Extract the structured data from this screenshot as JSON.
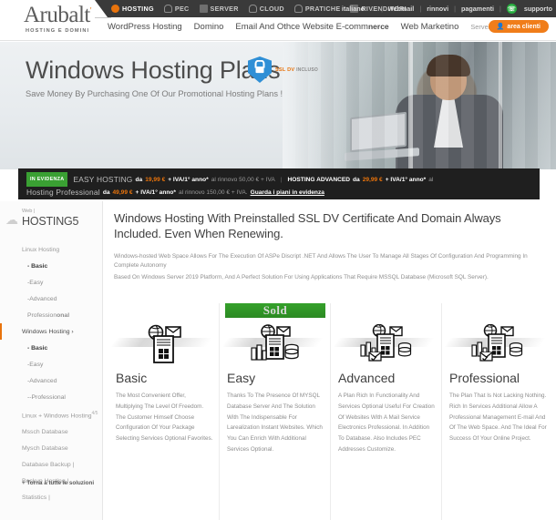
{
  "topbar": {
    "items": [
      {
        "label": "HOSTING",
        "icon": "globe-icon",
        "active": true
      },
      {
        "label": "PEC",
        "icon": "pin-icon",
        "active": false
      },
      {
        "label": "SERVER",
        "icon": "server-icon",
        "active": false
      },
      {
        "label": "CLOUD",
        "icon": "cloud-icon",
        "active": false
      },
      {
        "label": "PRATICHE",
        "icon": "check-circle-icon",
        "active": false
      },
      {
        "label": "RIVENDITORI",
        "icon": "list-icon",
        "active": false
      }
    ],
    "right": {
      "language": "italiano",
      "webmail": "webmail",
      "rinnovi": "rinnovi",
      "pagamenti": "pagamenti",
      "supporto": "supporto",
      "separator": "|"
    }
  },
  "header": {
    "logo": "Arubalt",
    "logo_tm": "'",
    "logo_sub": "HOSTING E DOMINI",
    "nav": [
      {
        "label": "WordPress Hosting",
        "style": "normal"
      },
      {
        "label": "Domino",
        "style": "normal"
      },
      {
        "label": "Email And Othce Website E-comm",
        "style": "normal"
      },
      {
        "label": "nerce",
        "style": "bold"
      },
      {
        "label": "Web Marketino",
        "style": "normal"
      },
      {
        "label": "Server And Cloud |",
        "style": "faint"
      }
    ],
    "area_clienti": "area clienti",
    "area_clienti_icon": "user-icon"
  },
  "hero": {
    "title": "Windows Hosting Plans",
    "subtitle": "Save Money By Purchasing One Of Our Promotional Hosting Plans !",
    "ssl_badge": {
      "text": "SSL DV",
      "suffix": "INCLUSO",
      "icon": "shield-lock-icon"
    }
  },
  "promo": {
    "tag": "IN EVIDENZA",
    "line1": {
      "name": "EASY HOSTING",
      "da": "da",
      "price": "19,99 €",
      "vat": "+ IVA/1° anno*",
      "renewal": "al rinnovo 50,00 € + IVA",
      "separator": "|",
      "name2": "HOSTING ADVANCED",
      "da2": "da",
      "price2": "29,99 €",
      "vat2": "+ IVA/1° anno*",
      "renewal2": "al"
    },
    "line2": {
      "name": "Hosting Professional",
      "da": "da",
      "price": "49,99 €",
      "vat": "+ IVA/1° anno*",
      "renewal": "al rinnovo 150,00 € + IVA.",
      "link": "Guarda i piani in evidenza"
    }
  },
  "sidebar": {
    "breadcrumb": "Web |",
    "title": "HOSTING",
    "title_sup": "5",
    "items": [
      {
        "label": "Linux Hosting",
        "type": "group"
      },
      {
        "label": "- Basic",
        "type": "bold-sub"
      },
      {
        "label": "-Easy",
        "type": "sub"
      },
      {
        "label": "-Advanced",
        "type": "sub"
      },
      {
        "label": "Profession",
        "type": "sub",
        "suffix": "onal"
      },
      {
        "label": "Windows Hosting ›",
        "type": "active"
      },
      {
        "label": "- Basic",
        "type": "bold-sub"
      },
      {
        "label": "-Easy",
        "type": "sub"
      },
      {
        "label": "-Advanced",
        "type": "sub"
      },
      {
        "label": "--Professional",
        "type": "sub"
      },
      {
        "label": "Linux + Windows Hosting",
        "type": "group",
        "sup": "4/5"
      },
      {
        "label": "Mssch Database",
        "type": "group"
      },
      {
        "label": "Mysch Database",
        "type": "group"
      },
      {
        "label": "Database Backup |",
        "type": "group"
      },
      {
        "label": "Backup Hosting |",
        "type": "group"
      },
      {
        "label": "Statistics |",
        "type": "group"
      }
    ],
    "back_link": "+ Torna a tutte le soluzioni"
  },
  "main": {
    "heading": "Windows Hosting With Preinstalled SSL DV Certificate And Domain Always Included. Even When Renewing.",
    "paragraph1": "Windows-hosted Web Space Allows For The Execution Of ASPe Discript .NET And Allows The User To Manage All Stages Of Configuration And Programming In Complete Autonomy",
    "paragraph2": "Based On Windows Server 2019 Platform, And A Perfect Solution For Using Applications That Require MSSQL Database (Microsoft SQL Server).",
    "cards": [
      {
        "title": "Basic",
        "icon": "windows-server-mail-icon",
        "ribbon": null,
        "description": "The Most Convenient Offer, Multiplying The Level Of Freedom. The Customer Himself Choose Configuration Of Your Package Selecting Services Optional Favorites."
      },
      {
        "title": "Easy",
        "icon": "windows-server-database-icon",
        "ribbon": "Sold",
        "description": "Thanks To The Presence Of MYSQL Database Server And The Solution With The Indispensable For Larealization Instant Websites. Which You Can Enrich With Additional Services Optional."
      },
      {
        "title": "Advanced",
        "icon": "windows-server-advanced-icon",
        "ribbon": null,
        "description": "A Plan Rich In Functionality And Services Optional Useful For Creation Of Websites With A Mail Service Electronics Professional. In Addition To Database. Also Includes PEC Addresses Customize."
      },
      {
        "title": "Professional",
        "icon": "windows-server-pro-icon",
        "ribbon": null,
        "description": "The Plan That Is Not Lacking Nothing. Rich In Services Additional Allow A Professional Management E-mail And Of The Web Space. And The Ideal For Success Of Your Online Project."
      }
    ]
  },
  "colors": {
    "accent_orange": "#e8730c",
    "dark_bar": "#3a3a3a",
    "promo_bar": "#1f1f1f",
    "green": "#3aa033",
    "ssl_blue": "#2f8fd6"
  }
}
